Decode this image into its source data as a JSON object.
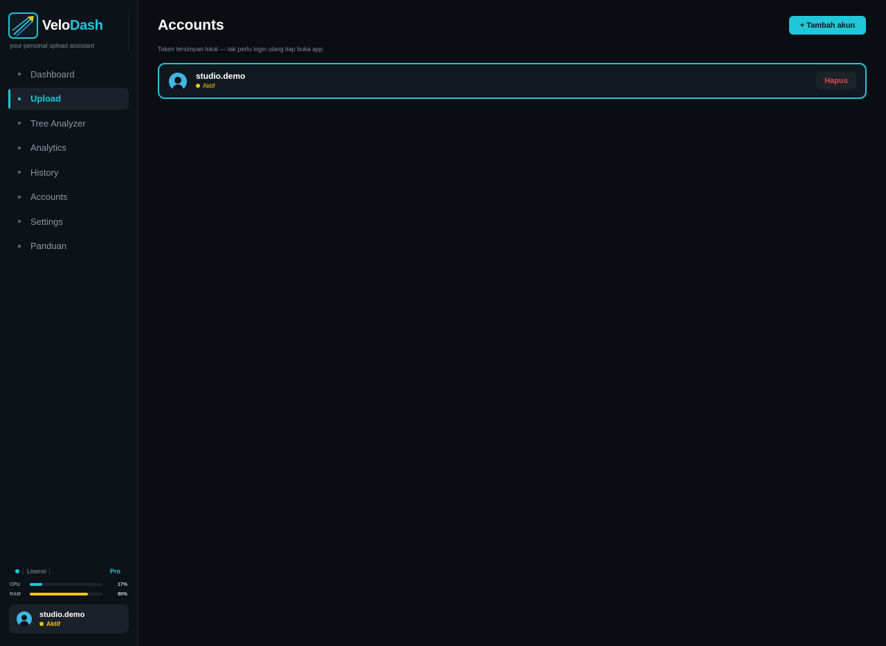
{
  "brand": {
    "name_part1": "Velo",
    "name_part2": "Dash",
    "tagline": "your personal upload assistant",
    "accent": "#21c7d9"
  },
  "sidebar": {
    "items": [
      {
        "label": "Dashboard",
        "active": false
      },
      {
        "label": "Upload",
        "active": true
      },
      {
        "label": "Tree Analyzer",
        "active": false
      },
      {
        "label": "Analytics",
        "active": false
      },
      {
        "label": "History",
        "active": false
      },
      {
        "label": "Accounts",
        "active": false
      },
      {
        "label": "Settings",
        "active": false
      },
      {
        "label": "Panduan",
        "active": false
      }
    ],
    "license": {
      "label": "Lisensi",
      "tier": "Pro"
    },
    "metrics": [
      {
        "label": "CPU",
        "value_text": "17%",
        "value": 0.17,
        "color": "#21c7d9"
      },
      {
        "label": "RAM",
        "value_text": "80%",
        "value": 0.8,
        "color": "#f5c518"
      }
    ],
    "user": {
      "name": "studio.demo",
      "status": "Aktif",
      "status_color": "#f5c518"
    }
  },
  "main": {
    "title": "Accounts",
    "subtitle": "Token tersimpan lokal — tak perlu login ulang tiap buka app.",
    "add_button": "+ Tambah akun",
    "accounts": [
      {
        "name": "studio.demo",
        "status": "Aktif",
        "delete_label": "Hapus"
      }
    ]
  }
}
